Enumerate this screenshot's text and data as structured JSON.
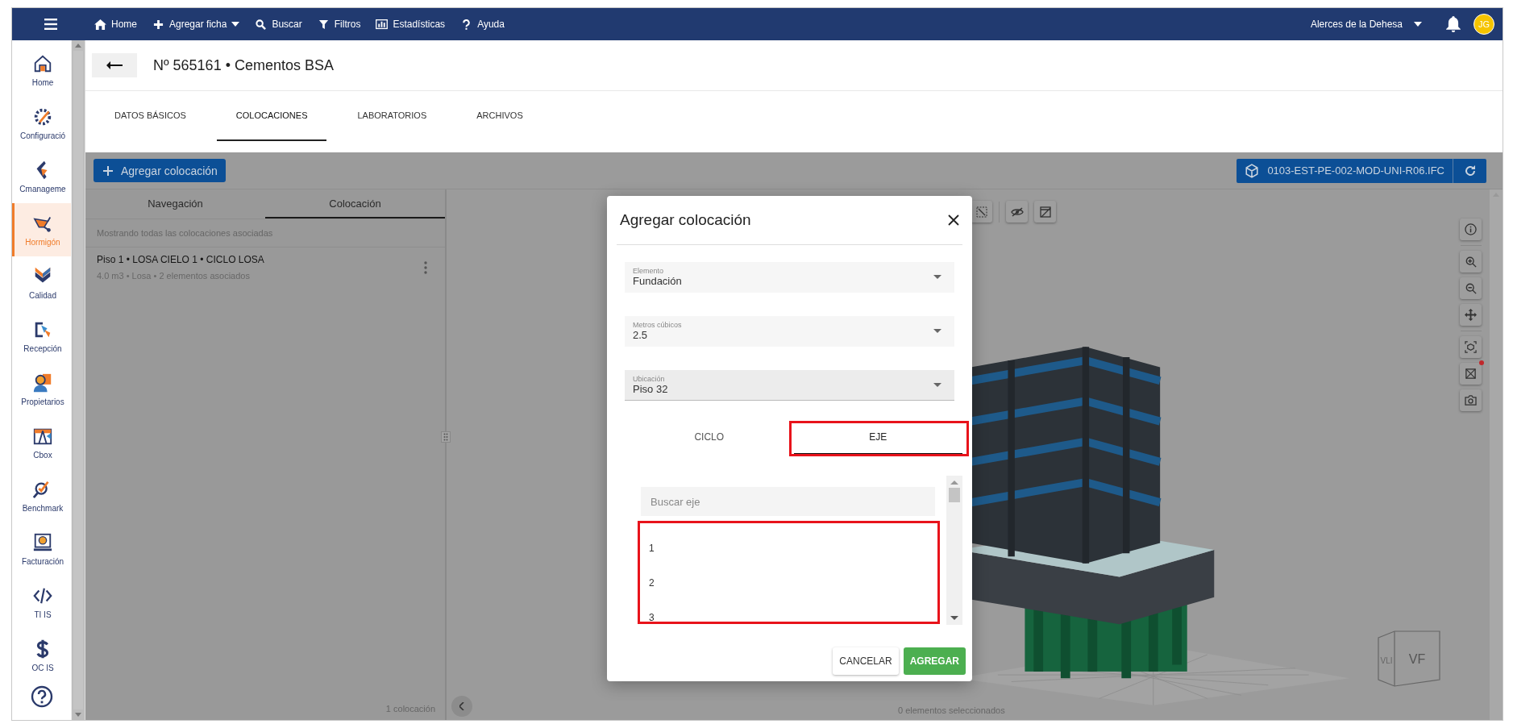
{
  "top_bar": {
    "items": [
      {
        "label": "Home",
        "has_dropdown": false
      },
      {
        "label": "Agregar ficha",
        "has_dropdown": true
      },
      {
        "label": "Buscar",
        "has_dropdown": false
      },
      {
        "label": "Filtros",
        "has_dropdown": false
      },
      {
        "label": "Estadísticas",
        "has_dropdown": false
      },
      {
        "label": "Ayuda",
        "has_dropdown": false
      }
    ],
    "project": "Alerces de la Dehesa",
    "avatar": "JG"
  },
  "sidebar": {
    "items": [
      {
        "label": "Home",
        "selected": false
      },
      {
        "label": "Configuració",
        "selected": false
      },
      {
        "label": "Cmanageme",
        "selected": false
      },
      {
        "label": "Hormigón",
        "selected": true
      },
      {
        "label": "Calidad",
        "selected": false
      },
      {
        "label": "Recepción",
        "selected": false
      },
      {
        "label": "Propietarios",
        "selected": false
      },
      {
        "label": "Cbox",
        "selected": false
      },
      {
        "label": "Benchmark",
        "selected": false
      },
      {
        "label": "Facturación",
        "selected": false
      },
      {
        "label": "TI IS",
        "selected": false
      },
      {
        "label": "OC IS",
        "selected": false
      }
    ]
  },
  "header": {
    "title": "Nº 565161 • Cementos BSA"
  },
  "tabs": [
    {
      "label": "DATOS BÁSICOS",
      "selected": false
    },
    {
      "label": "COLOCACIONES",
      "selected": true
    },
    {
      "label": "LABORATORIOS",
      "selected": false
    },
    {
      "label": "ARCHIVOS",
      "selected": false
    }
  ],
  "left_panel": {
    "add_button": "Agregar colocación",
    "tabs": [
      {
        "label": "Navegación",
        "selected": false
      },
      {
        "label": "Colocación",
        "selected": true
      }
    ],
    "info": "Mostrando todas las colocaciones asociadas",
    "items": [
      {
        "title": "Piso 1 • LOSA CIELO 1 • CICLO LOSA",
        "subtitle": "4.0 m3 • Losa • 2 elementos asociados"
      }
    ],
    "count": "1 colocación"
  },
  "viewer": {
    "file": "0103-EST-PE-002-MOD-UNI-R06.IFC",
    "status": "0 elementos seleccionados",
    "cube_faces": [
      "VLI",
      "VF"
    ]
  },
  "dialog": {
    "title": "Agregar colocación",
    "fields": [
      {
        "label": "Elemento",
        "value": "Fundación",
        "highlighted": false
      },
      {
        "label": "Metros cúbicos",
        "value": "2.5",
        "highlighted": false
      },
      {
        "label": "Ubicación",
        "value": "Piso 32",
        "highlighted": true
      }
    ],
    "tabs": [
      {
        "label": "CICLO",
        "selected": false,
        "annotated": false
      },
      {
        "label": "EJE",
        "selected": true,
        "annotated": true
      }
    ],
    "search": {
      "placeholder": "Buscar eje"
    },
    "axes": {
      "annotated": true,
      "items": [
        "1",
        "2",
        "3"
      ]
    },
    "buttons": [
      {
        "label": "CANCELAR",
        "kind": "secondary"
      },
      {
        "label": "AGREGAR",
        "kind": "primary"
      }
    ]
  }
}
